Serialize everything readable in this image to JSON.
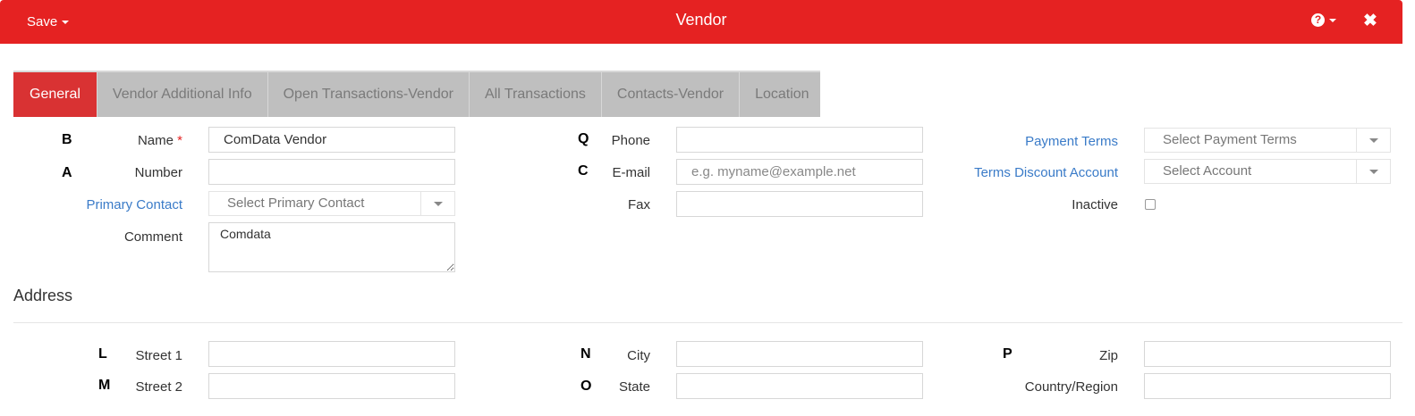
{
  "header": {
    "save_label": "Save",
    "title": "Vendor",
    "help_icon": "?",
    "close_icon": "✖",
    "background_color": "#e52222"
  },
  "tabs": [
    {
      "label": "General",
      "active": true
    },
    {
      "label": "Vendor Additional Info",
      "active": false
    },
    {
      "label": "Open Transactions-Vendor",
      "active": false
    },
    {
      "label": "All Transactions",
      "active": false
    },
    {
      "label": "Contacts-Vendor",
      "active": false
    },
    {
      "label": "Location",
      "active": false
    }
  ],
  "general": {
    "name": {
      "label": "Name",
      "required_mark": "*",
      "value": "ComData Vendor",
      "marker": "B"
    },
    "number": {
      "label": "Number",
      "value": "",
      "marker": "A"
    },
    "primary_contact": {
      "label": "Primary Contact",
      "placeholder": "Select Primary Contact"
    },
    "comment": {
      "label": "Comment",
      "value": "Comdata"
    },
    "phone": {
      "label": "Phone",
      "value": "",
      "marker": "Q"
    },
    "email": {
      "label": "E-mail",
      "placeholder": "e.g. myname@example.net",
      "marker": "C"
    },
    "fax": {
      "label": "Fax",
      "value": ""
    },
    "payment_terms": {
      "label": "Payment Terms",
      "placeholder": "Select Payment Terms"
    },
    "terms_discount_account": {
      "label": "Terms Discount Account",
      "placeholder": "Select Account"
    },
    "inactive": {
      "label": "Inactive",
      "checked": false
    }
  },
  "address": {
    "title": "Address",
    "street1": {
      "label": "Street 1",
      "value": "",
      "marker": "L"
    },
    "street2": {
      "label": "Street 2",
      "value": "",
      "marker": "M"
    },
    "city": {
      "label": "City",
      "value": "",
      "marker": "N"
    },
    "state": {
      "label": "State",
      "value": "",
      "marker": "O"
    },
    "zip": {
      "label": "Zip",
      "value": "",
      "marker": "P"
    },
    "country": {
      "label": "Country/Region",
      "value": ""
    }
  },
  "colors": {
    "accent": "#e52222",
    "active_tab": "#d93233",
    "link": "#3a7bc8"
  }
}
